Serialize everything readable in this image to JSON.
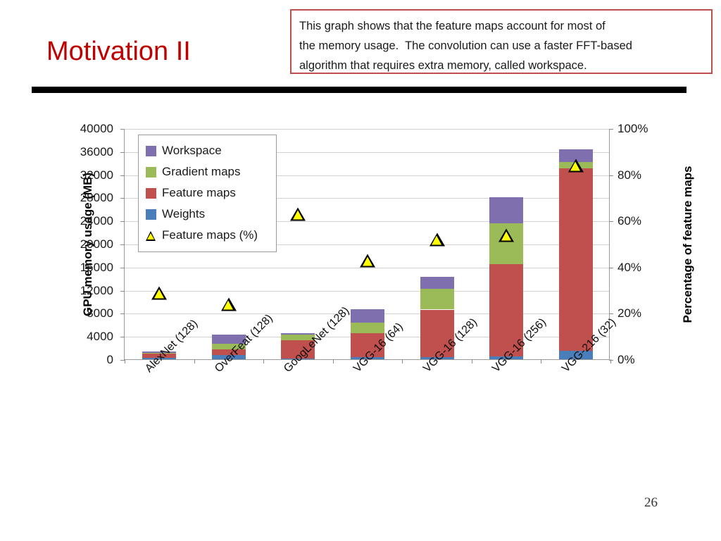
{
  "slide": {
    "title": "Motivation II",
    "title_color": "#c00000",
    "page_number": "26"
  },
  "annotation": {
    "border_color": "#c0504d",
    "lines": [
      "This graph shows that the feature maps account for most of",
      "the memory usage.  The convolution can use a faster FFT-based",
      "algorithm that requires extra memory, called workspace."
    ]
  },
  "legend": {
    "items": [
      {
        "label": "Workspace",
        "color": "#7f6fae",
        "marker": "square"
      },
      {
        "label": "Gradient maps",
        "color": "#9bbb59",
        "marker": "square"
      },
      {
        "label": "Feature maps",
        "color": "#c0504d",
        "marker": "square"
      },
      {
        "label": "Weights",
        "color": "#4a7ebb",
        "marker": "square"
      },
      {
        "label": "Feature maps (%)",
        "color": "#ffff00",
        "marker": "triangle"
      }
    ]
  },
  "chart_data": {
    "type": "bar",
    "subtype": "stacked-bar-with-secondary-axis-scatter",
    "title": "",
    "xlabel": "",
    "ylabel": "GPU memory usage (MB)",
    "y2label": "Percentage of feature maps",
    "ylim": [
      0,
      40000
    ],
    "ytick_step": 4000,
    "yticks": [
      0,
      4000,
      8000,
      12000,
      16000,
      20000,
      24000,
      28000,
      32000,
      36000,
      40000
    ],
    "ytick_labels": [
      "0",
      "4000",
      "8000",
      "12000",
      "16000",
      "20000",
      "24000",
      "28000",
      "32000",
      "36000",
      "40000"
    ],
    "y2lim": [
      0,
      100
    ],
    "y2tick_step": 20,
    "y2ticks": [
      0,
      20,
      40,
      60,
      80,
      100
    ],
    "y2tick_labels": [
      "0%",
      "20%",
      "40%",
      "60%",
      "80%",
      "100%"
    ],
    "grid": true,
    "legend_position": "inside-top-left",
    "categories": [
      "AlexNet (128)",
      "OverFeat (128)",
      "GoogLeNet (128)",
      "VGG-16 (64)",
      "VGG-16 (128)",
      "VGG-16 (256)",
      "VGG-216 (32)"
    ],
    "series": [
      {
        "name": "Weights",
        "color": "#4a7ebb",
        "values": [
          240,
          700,
          120,
          350,
          400,
          500,
          1500
        ]
      },
      {
        "name": "Feature maps",
        "color": "#c0504d",
        "values": [
          700,
          1000,
          3150,
          4150,
          8200,
          16000,
          31500
        ]
      },
      {
        "name": "Gradient maps",
        "color": "#9bbb59",
        "values": [
          150,
          1000,
          1000,
          1800,
          3600,
          7000,
          1200
        ]
      },
      {
        "name": "Workspace",
        "color": "#7f6fae",
        "values": [
          250,
          1600,
          300,
          2300,
          2100,
          4500,
          2200
        ]
      }
    ],
    "secondary_series": {
      "name": "Feature maps (%)",
      "color": "#ffff00",
      "axis": "y2",
      "marker": "triangle",
      "values": [
        32,
        27,
        66,
        46,
        55,
        57,
        87
      ]
    }
  }
}
